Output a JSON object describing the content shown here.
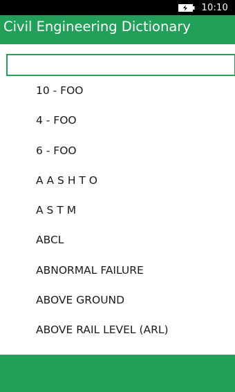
{
  "colors": {
    "accent": "#22a05a",
    "status_bar": "#000000",
    "background": "#ffffff",
    "text": "#1a1a1a"
  },
  "status_bar": {
    "time": "10:10",
    "battery_icon": "battery-charging-icon"
  },
  "header": {
    "title": "Civil Engineering Dictionary"
  },
  "search": {
    "value": "",
    "placeholder": ""
  },
  "terms": [
    "10 - FOO",
    "4 - FOO",
    "6 - FOO",
    "A A S H T O",
    "A S T M",
    "ABCL",
    "ABNORMAL FAILURE",
    "ABOVE GROUND",
    "ABOVE RAIL LEVEL (ARL)"
  ]
}
